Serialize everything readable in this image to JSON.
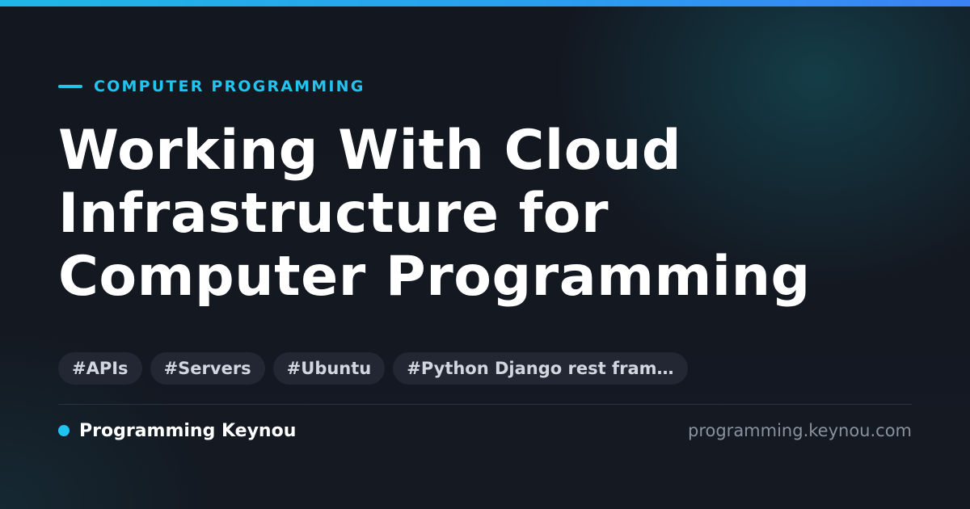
{
  "header": {
    "category": "COMPUTER PROGRAMMING",
    "title_lines": [
      "Working With Cloud",
      "Infrastructure for",
      "Computer Programming"
    ]
  },
  "tags": [
    "#APIs",
    "#Servers",
    "#Ubuntu",
    "#Python Django rest fram…"
  ],
  "footer": {
    "brand": "Programming Keynou",
    "domain": "programming.keynou.com"
  },
  "colors": {
    "accent": "#22c3ee",
    "background": "#141821",
    "title": "#ffffff",
    "tag_background": "#222733",
    "muted": "#8a919e"
  },
  "icons": {
    "eyebrow": "accent-line",
    "brand": "dot-icon"
  }
}
